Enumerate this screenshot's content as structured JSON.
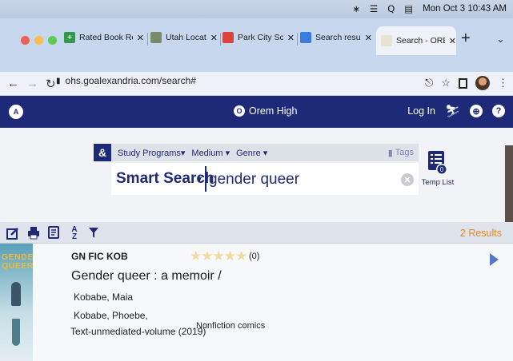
{
  "menubar": {
    "clock": "Mon Oct 3  10:43 AM"
  },
  "browser": {
    "tabs": [
      {
        "label": "Rated Book Reviews",
        "favicon_color": "#2e9a4a",
        "favicon_glyph": "+"
      },
      {
        "label": "Utah Locations | F",
        "favicon_color": "#7a8b6a",
        "favicon_glyph": ""
      },
      {
        "label": "Park City School E",
        "favicon_color": "#d9453c",
        "favicon_glyph": ""
      },
      {
        "label": "Search results - G",
        "favicon_color": "#3b7be0",
        "favicon_glyph": ""
      },
      {
        "label": "Search - OREMHS",
        "favicon_color": "#e8e2d0",
        "favicon_glyph": ""
      }
    ],
    "url": "ohs.goalexandria.com/search#"
  },
  "site": {
    "title": "Orem High",
    "login": "Log In"
  },
  "search": {
    "filters": {
      "programs": "Study Programs",
      "medium": "Medium",
      "genre": "Genre",
      "tags": "Tags"
    },
    "mode": "Smart Search",
    "query": "gender queer",
    "temp_list": "Temp List"
  },
  "results": {
    "count": "2 Results",
    "items": [
      {
        "cover_text": "GENDER QUEER",
        "call_number": "GN FIC KOB",
        "rating_count": "(0)",
        "title": "Gender queer : a memoir /",
        "author1": "Kobabe, Maia",
        "author2": "Kobabe, Phoebe,",
        "format": "Text-unmediated-volume (2019)",
        "genre": "Nonfiction comics"
      }
    ]
  },
  "colors": {
    "site_navy": "#1e2a78",
    "results_orange": "#e38a1e",
    "expand_blue": "#5677c4"
  }
}
